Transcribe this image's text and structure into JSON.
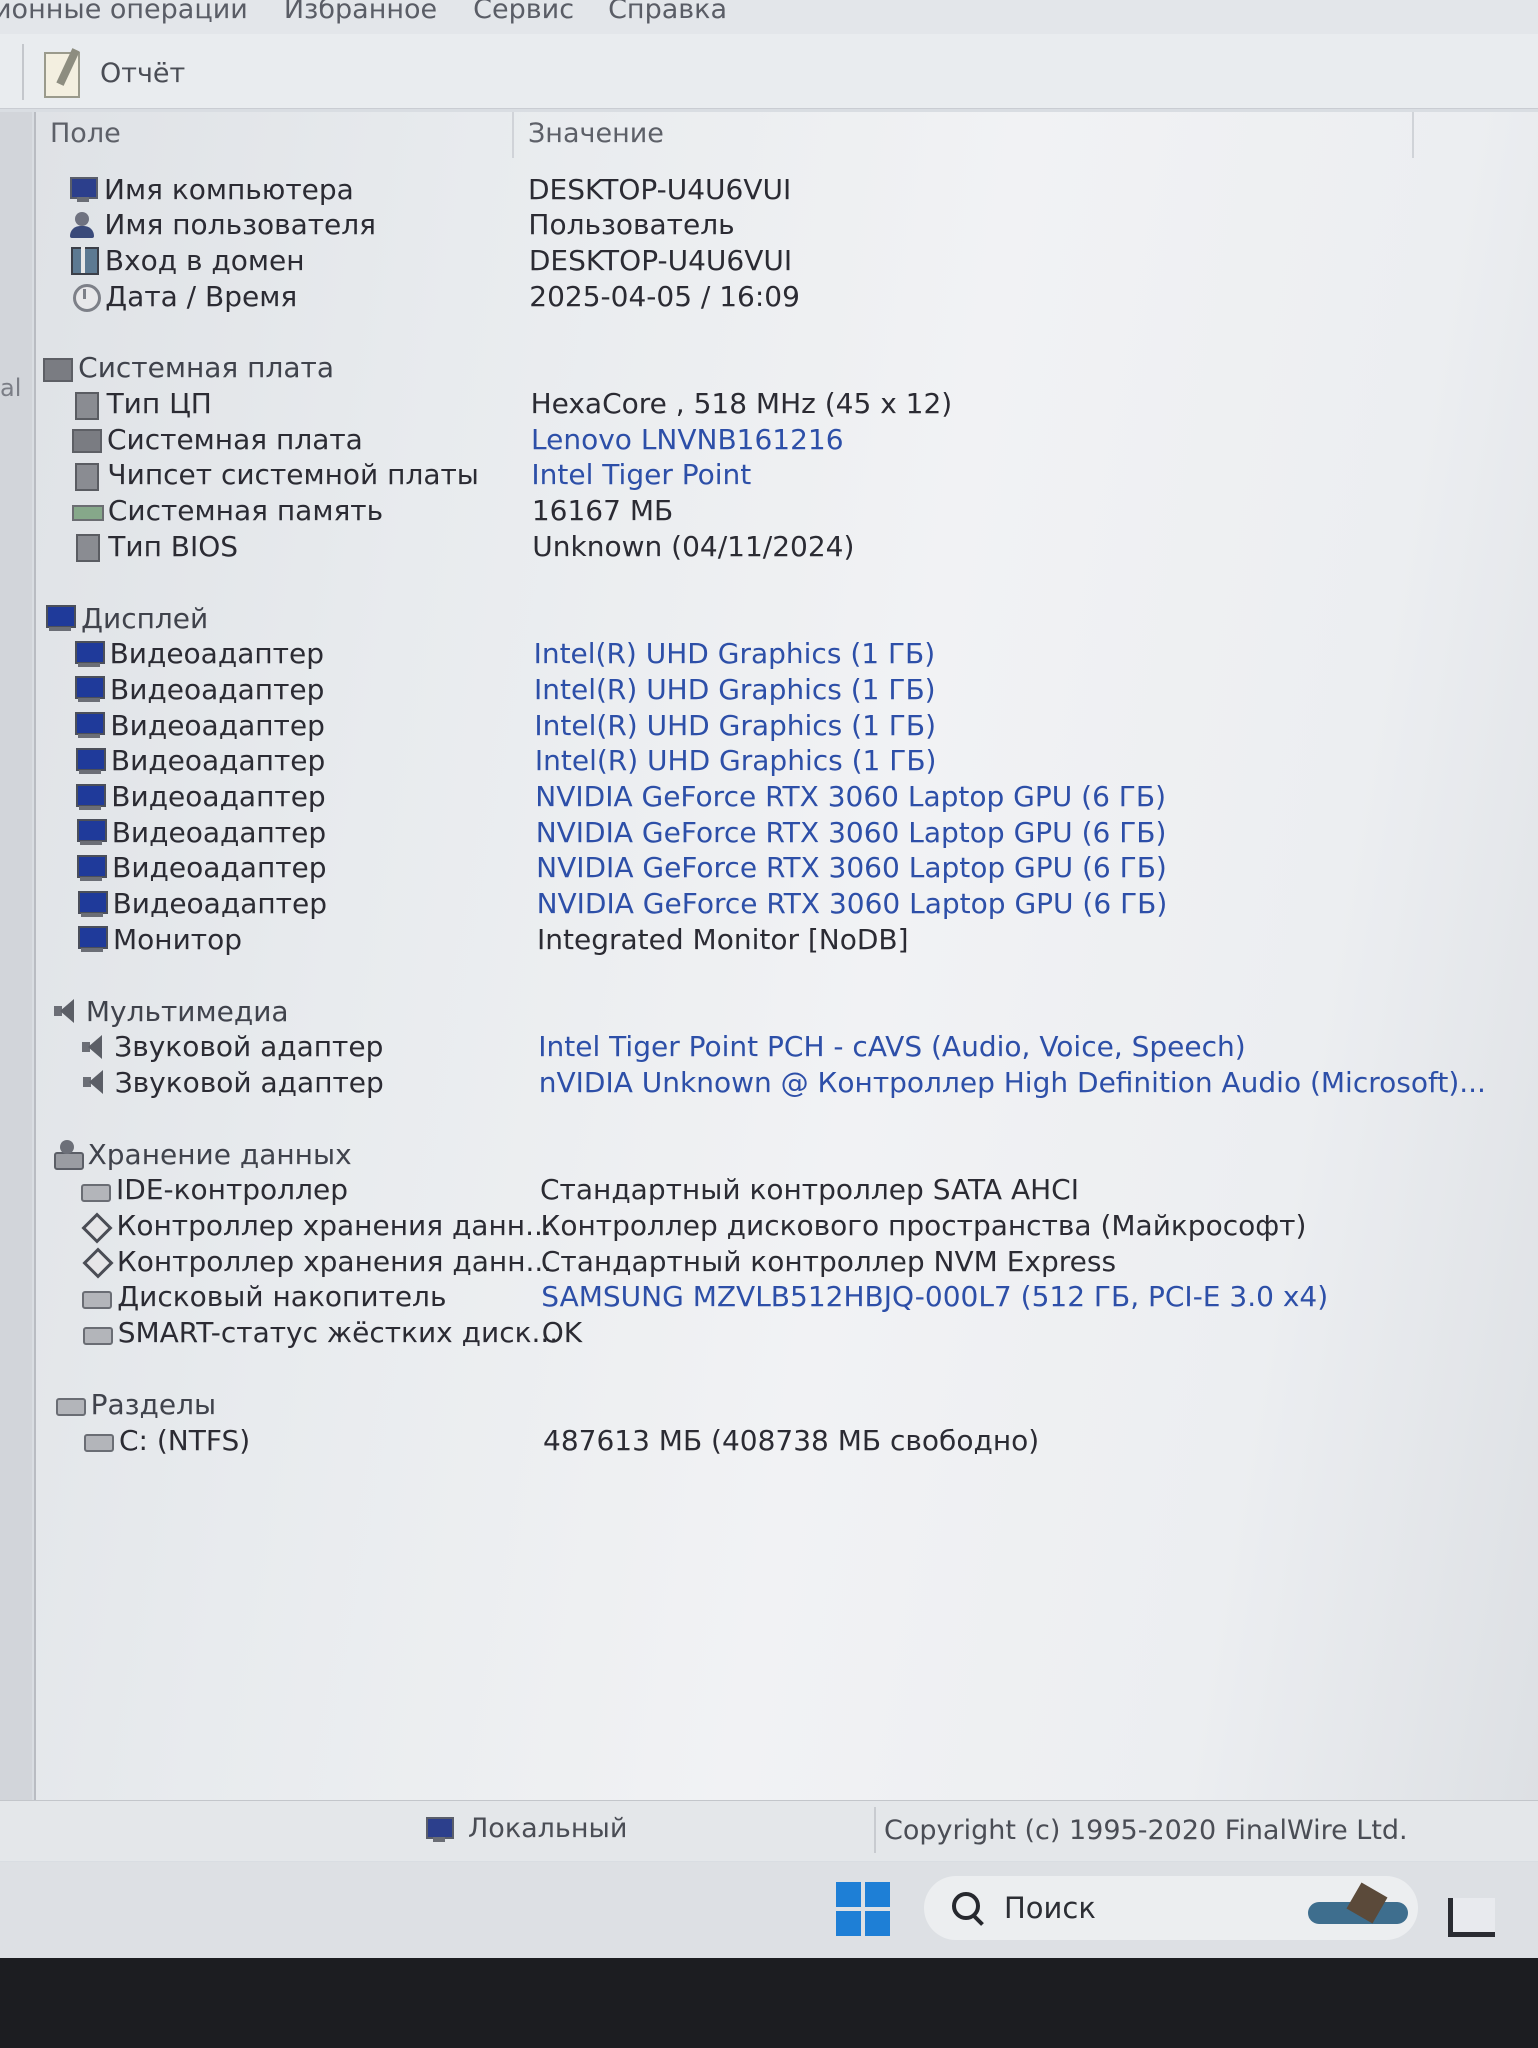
{
  "menu": [
    "ионные операции",
    "Избранное",
    "Сервис",
    "Справка"
  ],
  "toolbar": {
    "report_label": "Отчёт"
  },
  "left_strip_char": "al",
  "columns": {
    "field": "Поле",
    "value": "Значение"
  },
  "rows": [
    {
      "kind": "item",
      "icon": "computer-icon",
      "cls": "i-pc",
      "label": "Имя компьютера",
      "value": "DESKTOP-U4U6VUI",
      "link": false
    },
    {
      "kind": "item",
      "icon": "user-icon",
      "cls": "i-user",
      "label": "Имя пользователя",
      "value": "Пользователь",
      "link": false
    },
    {
      "kind": "item",
      "icon": "domain-icon",
      "cls": "i-net",
      "label": "Вход в домен",
      "value": "DESKTOP-U4U6VUI",
      "link": false
    },
    {
      "kind": "item",
      "icon": "clock-icon",
      "cls": "i-clock",
      "label": "Дата / Время",
      "value": "2025-04-05 / 16:09",
      "link": false
    },
    {
      "kind": "category",
      "icon": "motherboard-icon",
      "cls": "i-board",
      "label": "Системная плата"
    },
    {
      "kind": "item",
      "icon": "cpu-icon",
      "cls": "i-chip",
      "label": "Тип ЦП",
      "value": "HexaCore , 518 MHz (45 x 12)",
      "link": false
    },
    {
      "kind": "item",
      "icon": "motherboard-icon",
      "cls": "i-board",
      "label": "Системная плата",
      "value": "Lenovo LNVNB161216",
      "link": true
    },
    {
      "kind": "item",
      "icon": "chipset-icon",
      "cls": "i-chip",
      "label": "Чипсет системной платы",
      "value": "Intel Tiger Point",
      "link": true
    },
    {
      "kind": "item",
      "icon": "memory-icon",
      "cls": "i-ram",
      "label": "Системная память",
      "value": "16167 МБ",
      "link": false
    },
    {
      "kind": "item",
      "icon": "bios-icon",
      "cls": "i-chip",
      "label": "Тип BIOS",
      "value": "Unknown (04/11/2024)",
      "link": false
    },
    {
      "kind": "category",
      "icon": "display-icon",
      "cls": "i-disp",
      "label": "Дисплей"
    },
    {
      "kind": "item",
      "icon": "display-adapter-icon",
      "cls": "i-disp",
      "label": "Видеоадаптер",
      "value": "Intel(R) UHD Graphics  (1 ГБ)",
      "link": true
    },
    {
      "kind": "item",
      "icon": "display-adapter-icon",
      "cls": "i-disp",
      "label": "Видеоадаптер",
      "value": "Intel(R) UHD Graphics  (1 ГБ)",
      "link": true
    },
    {
      "kind": "item",
      "icon": "display-adapter-icon",
      "cls": "i-disp",
      "label": "Видеоадаптер",
      "value": "Intel(R) UHD Graphics  (1 ГБ)",
      "link": true
    },
    {
      "kind": "item",
      "icon": "display-adapter-icon",
      "cls": "i-disp",
      "label": "Видеоадаптер",
      "value": "Intel(R) UHD Graphics  (1 ГБ)",
      "link": true
    },
    {
      "kind": "item",
      "icon": "display-adapter-icon",
      "cls": "i-disp",
      "label": "Видеоадаптер",
      "value": "NVIDIA GeForce RTX 3060 Laptop GPU  (6 ГБ)",
      "link": true
    },
    {
      "kind": "item",
      "icon": "display-adapter-icon",
      "cls": "i-disp",
      "label": "Видеоадаптер",
      "value": "NVIDIA GeForce RTX 3060 Laptop GPU  (6 ГБ)",
      "link": true
    },
    {
      "kind": "item",
      "icon": "display-adapter-icon",
      "cls": "i-disp",
      "label": "Видеоадаптер",
      "value": "NVIDIA GeForce RTX 3060 Laptop GPU  (6 ГБ)",
      "link": true
    },
    {
      "kind": "item",
      "icon": "display-adapter-icon",
      "cls": "i-disp",
      "label": "Видеоадаптер",
      "value": "NVIDIA GeForce RTX 3060 Laptop GPU  (6 ГБ)",
      "link": true
    },
    {
      "kind": "item",
      "icon": "monitor-icon",
      "cls": "i-disp",
      "label": "Монитор",
      "value": "Integrated Monitor [NoDB]",
      "link": false
    },
    {
      "kind": "category",
      "icon": "speaker-icon",
      "cls": "i-snd",
      "label": "Мультимедиа"
    },
    {
      "kind": "item",
      "icon": "speaker-icon",
      "cls": "i-snd",
      "label": "Звуковой адаптер",
      "value": "Intel Tiger Point PCH - cAVS (Audio, Voice, Speech)",
      "link": true
    },
    {
      "kind": "item",
      "icon": "speaker-icon",
      "cls": "i-snd",
      "label": "Звуковой адаптер",
      "value": "nVIDIA Unknown @ Контроллер High Definition Audio (Microsoft)...",
      "link": true
    },
    {
      "kind": "category",
      "icon": "storage-icon",
      "cls": "i-stor",
      "label": "Хранение данных"
    },
    {
      "kind": "item",
      "icon": "ide-controller-icon",
      "cls": "i-hdd",
      "label": "IDE-контроллер",
      "value": "Стандартный контроллер SATA AHCI",
      "link": false
    },
    {
      "kind": "item",
      "icon": "storage-controller-icon",
      "cls": "i-diam",
      "label": "Контроллер хранения данн...",
      "value": "Контроллер дискового пространства (Майкрософт)",
      "link": false
    },
    {
      "kind": "item",
      "icon": "storage-controller-icon",
      "cls": "i-diam",
      "label": "Контроллер хранения данн...",
      "value": "Стандартный контроллер NVM Express",
      "link": false
    },
    {
      "kind": "item",
      "icon": "disk-drive-icon",
      "cls": "i-hdd",
      "label": "Дисковый накопитель",
      "value": "SAMSUNG MZVLB512HBJQ-000L7  (512 ГБ, PCI-E 3.0 x4)",
      "link": true
    },
    {
      "kind": "item",
      "icon": "smart-status-icon",
      "cls": "i-hdd",
      "label": "SMART-статус жёстких диск...",
      "value": "OK",
      "link": false
    },
    {
      "kind": "category",
      "icon": "partitions-icon",
      "cls": "i-hdd",
      "label": "Разделы"
    },
    {
      "kind": "item",
      "icon": "drive-c-icon",
      "cls": "i-hdd",
      "label": "C: (NTFS)",
      "value": "487613 МБ (408738 МБ свободно)",
      "link": false
    }
  ],
  "status": {
    "left": "Локальный",
    "right": "Copyright (c) 1995-2020 FinalWire Ltd."
  },
  "taskbar": {
    "search_label": "Поиск"
  }
}
